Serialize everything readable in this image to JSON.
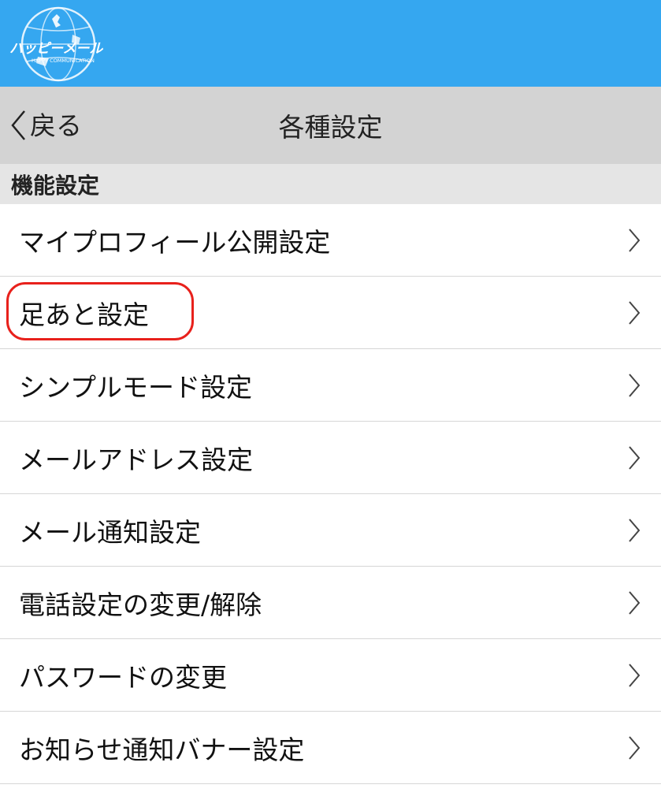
{
  "header": {
    "logo_text": "ハッピーメール",
    "logo_subtext": "HAPPY COMMUNICATION",
    "background_color": "#35a7f0"
  },
  "nav": {
    "back_label": "戻る",
    "title": "各種設定"
  },
  "section": {
    "title": "機能設定"
  },
  "menu": {
    "items": [
      {
        "label": "マイプロフィール公開設定"
      },
      {
        "label": "足あと設定",
        "highlighted": true
      },
      {
        "label": "シンプルモード設定"
      },
      {
        "label": "メールアドレス設定"
      },
      {
        "label": "メール通知設定"
      },
      {
        "label": "電話設定の変更/解除"
      },
      {
        "label": "パスワードの変更"
      },
      {
        "label": "お知らせ通知バナー設定"
      }
    ]
  },
  "icons": {
    "back": "chevron-left-icon",
    "item": "chevron-right-icon",
    "logo": "globe-logo-icon"
  },
  "colors": {
    "highlight": "#e8211c",
    "nav_bg": "#d3d3d3",
    "section_bg": "#e5e5e5"
  }
}
